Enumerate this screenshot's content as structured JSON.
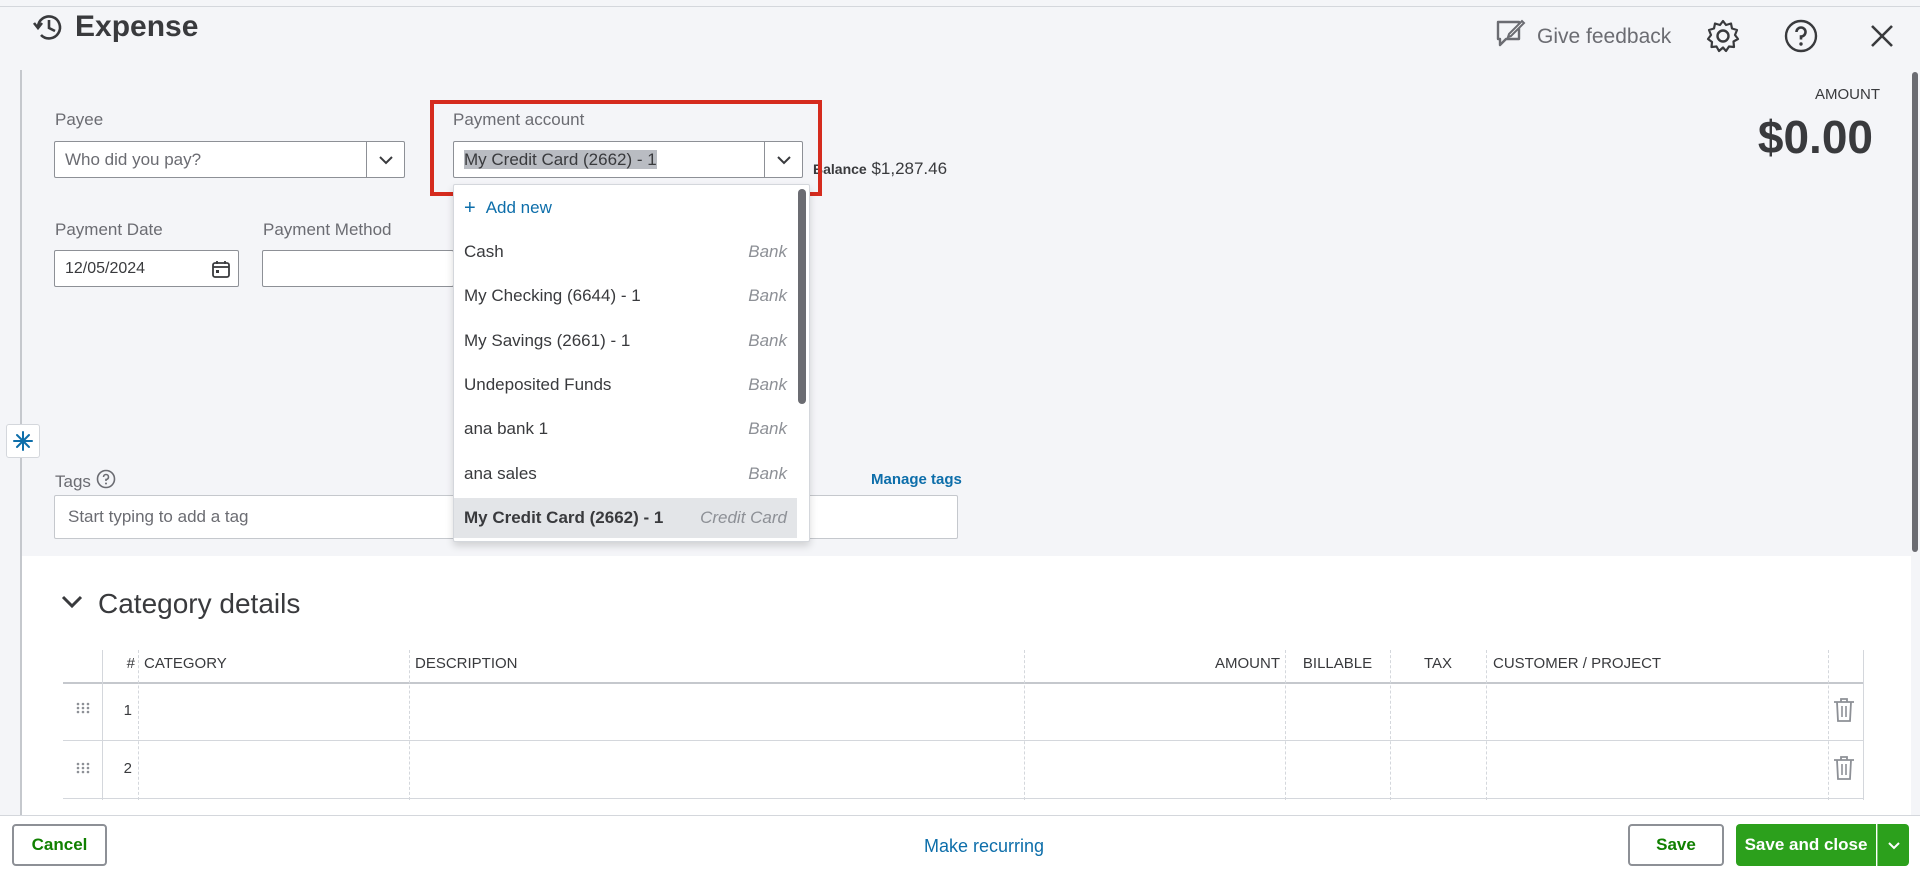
{
  "header": {
    "title": "Expense",
    "feedback_label": "Give feedback"
  },
  "form": {
    "payee": {
      "label": "Payee",
      "placeholder": "Who did you pay?"
    },
    "payment_account": {
      "label": "Payment account",
      "value": "My Credit Card (2662) - 1"
    },
    "balance": {
      "label": "Balance",
      "value": "$1,287.46"
    },
    "payment_date": {
      "label": "Payment Date",
      "value": "12/05/2024"
    },
    "payment_method": {
      "label": "Payment Method",
      "value": ""
    },
    "tags": {
      "label": "Tags",
      "placeholder": "Start typing to add a tag",
      "manage_link": "Manage tags"
    }
  },
  "amount": {
    "label": "AMOUNT",
    "value": "$0.00"
  },
  "dropdown": {
    "add_new": "Add new",
    "items": [
      {
        "name": "Cash",
        "type": "Bank"
      },
      {
        "name": "My Checking (6644) - 1",
        "type": "Bank"
      },
      {
        "name": "My Savings (2661) - 1",
        "type": "Bank"
      },
      {
        "name": "Undeposited Funds",
        "type": "Bank"
      },
      {
        "name": "ana bank 1",
        "type": "Bank"
      },
      {
        "name": "ana sales",
        "type": "Bank"
      },
      {
        "name": "My Credit Card (2662) - 1",
        "type": "Credit Card",
        "selected": true
      }
    ]
  },
  "category_details": {
    "title": "Category details",
    "columns": [
      "#",
      "CATEGORY",
      "DESCRIPTION",
      "AMOUNT",
      "BILLABLE",
      "TAX",
      "CUSTOMER / PROJECT"
    ],
    "rows": [
      {
        "num": "1"
      },
      {
        "num": "2"
      }
    ]
  },
  "footer": {
    "cancel": "Cancel",
    "make_recurring": "Make recurring",
    "save": "Save",
    "save_and_close": "Save and close"
  },
  "colors": {
    "accent_green": "#2ca01c",
    "highlight_red": "#d52b1e",
    "link_blue": "#0d6eaa"
  }
}
